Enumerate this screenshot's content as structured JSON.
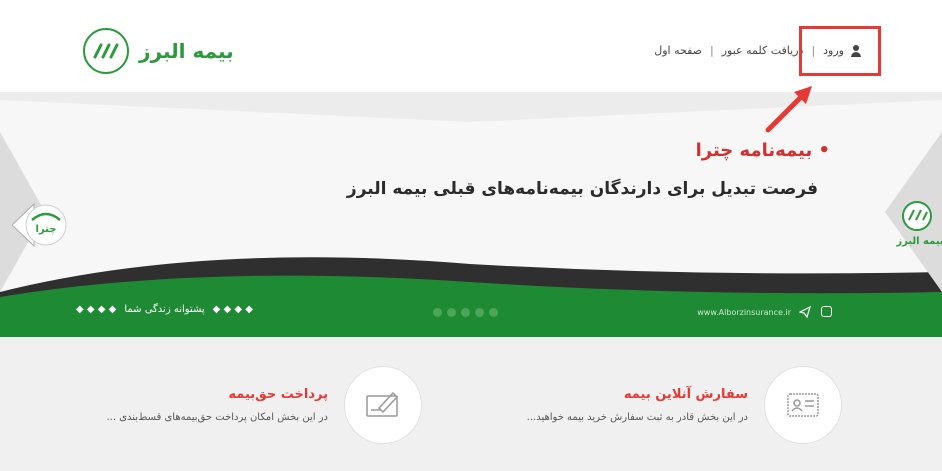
{
  "header": {
    "logo_text": "بیمه البرز",
    "logo_badge": "ALBORZ",
    "nav": {
      "login": "ورود",
      "separator": "|",
      "get_password": "دریافت کلمه عبور",
      "home": "صفحه اول"
    }
  },
  "banner": {
    "chatra_title": "• بیمه‌نامه چترا",
    "headline": "فرصت تبدیل برای دارندگان بیمه‌نامه‌های قبلی بیمه البرز",
    "left_nav_label": "چترا",
    "right_nav_label": "بیمه البرز",
    "tagline": "پشتوانه زندگی شما",
    "tagline_deco": "◆ ◆ ◆ ◆",
    "url": "www.Alborzinsurance.ir",
    "dots_count": 5
  },
  "services": [
    {
      "title": "سفارش آنلاین بیمه",
      "desc": "در این بخش قادر به ثبت سفارش خرید بیمه خواهید...",
      "icon": "id-card-icon"
    },
    {
      "title": "پرداخت حق‌بیمه",
      "desc": "در این بخش امکان پرداخت حق‌بیمه‌های قسط‌بندی ...",
      "icon": "check-signing-icon"
    }
  ],
  "colors": {
    "brand_green": "#2c9a3d",
    "accent_red": "#e53935"
  }
}
